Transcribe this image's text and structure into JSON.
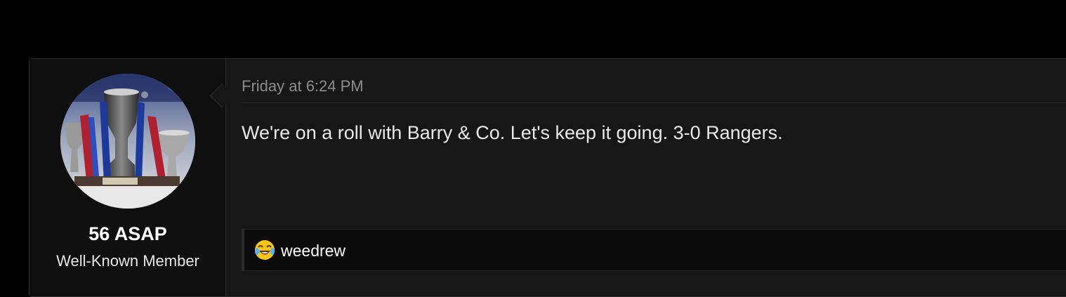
{
  "post": {
    "author": {
      "name": "56 ASAP",
      "title": "Well-Known Member",
      "avatar_icon": "trophy-avatar"
    },
    "timestamp": "Friday at 6:24 PM",
    "message": "We're on a roll with Barry & Co. Let's keep it going. 3-0 Rangers.",
    "reactions": {
      "icon": "laughing-tears-emoji",
      "users": "weedrew"
    }
  },
  "colors": {
    "page_bg": "#000000",
    "post_bg": "#171717",
    "user_cell_bg": "#0f0f0f",
    "reaction_bar_bg": "#0b0b0b",
    "timestamp": "#8c8c8c",
    "text": "#e8e8e8"
  }
}
